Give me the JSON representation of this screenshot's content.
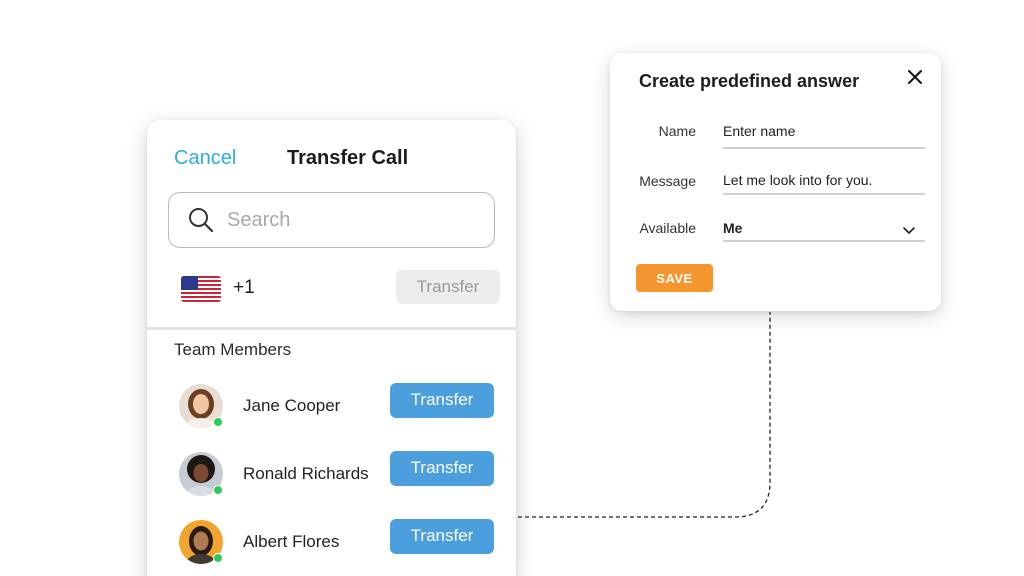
{
  "transfer_call": {
    "cancel_label": "Cancel",
    "title": "Transfer Call",
    "search_placeholder": "Search",
    "country_code": "+1",
    "flag": "us-flag-icon",
    "transfer_label": "Transfer",
    "section_label": "Team Members",
    "members": [
      {
        "name": "Jane Cooper",
        "button": "Transfer",
        "status": "online",
        "avatar_bg": "#c9a98c"
      },
      {
        "name": "Ronald Richards",
        "button": "Transfer",
        "status": "online",
        "avatar_bg": "#9aa2b0"
      },
      {
        "name": "Albert Flores",
        "button": "Transfer",
        "status": "online",
        "avatar_bg": "#f0a830"
      }
    ]
  },
  "predefined_answer": {
    "title": "Create predefined answer",
    "close_icon": "close-icon",
    "fields": [
      {
        "label": "Name",
        "value": "Enter name"
      },
      {
        "label": "Message",
        "value": "Let me look into for you."
      },
      {
        "label": "Available",
        "value": "Me"
      }
    ],
    "save_label": "SAVE"
  },
  "colors": {
    "accent_blue": "#4a9fdc",
    "cancel_blue": "#2ab0de",
    "save_orange": "#f5952e",
    "online_green": "#2ec95c"
  }
}
